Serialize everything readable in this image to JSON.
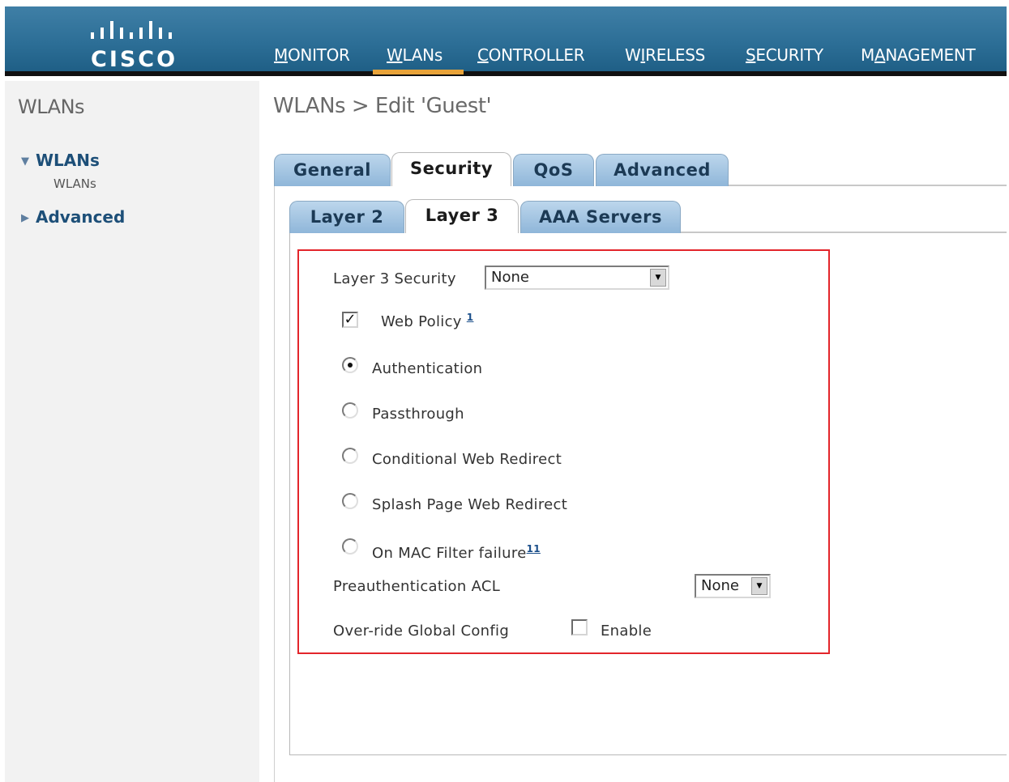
{
  "header": {
    "brand": "CISCO",
    "nav": [
      {
        "label": "MONITOR",
        "key": "M",
        "rest": "ONITOR"
      },
      {
        "label": "WLANs",
        "key": "W",
        "rest": "LANs"
      },
      {
        "label": "CONTROLLER",
        "key": "C",
        "rest": "ONTROLLER"
      },
      {
        "label": "WIRELESS",
        "pre": "W",
        "key": "I",
        "rest": "RELESS"
      },
      {
        "label": "SECURITY",
        "key": "S",
        "rest": "ECURITY"
      },
      {
        "label": "MANAGEMENT",
        "pre": "M",
        "key": "A",
        "rest": "NAGEMENT"
      }
    ],
    "active": "WLANs",
    "accent": "#e8a33a"
  },
  "sidebar": {
    "title": "WLANs",
    "items": [
      {
        "label": "WLANs",
        "expanded": true,
        "children": [
          "WLANs"
        ]
      },
      {
        "label": "Advanced",
        "expanded": false
      }
    ]
  },
  "main": {
    "title": "WLANs > Edit  'Guest'",
    "tabs": [
      "General",
      "Security",
      "QoS",
      "Advanced"
    ],
    "active_tab": "Security",
    "subtabs": [
      "Layer 2",
      "Layer 3",
      "AAA Servers"
    ],
    "active_subtab": "Layer 3",
    "form": {
      "layer3_security_label": "Layer 3 Security",
      "layer3_security_value": "None",
      "web_policy_label": "Web Policy",
      "web_policy_checked": true,
      "web_policy_note": "1",
      "radios": [
        {
          "label": "Authentication",
          "selected": true,
          "note": ""
        },
        {
          "label": "Passthrough",
          "selected": false,
          "note": ""
        },
        {
          "label": "Conditional Web Redirect",
          "selected": false,
          "note": ""
        },
        {
          "label": "Splash Page Web Redirect",
          "selected": false,
          "note": ""
        },
        {
          "label": "On MAC Filter failure",
          "selected": false,
          "note": "11"
        }
      ],
      "preauth_acl_label": "Preauthentication ACL",
      "preauth_acl_value": "None",
      "override_label": "Over-ride Global Config",
      "override_checkbox_label": "Enable",
      "override_checked": false
    },
    "highlight_color": "#e3252b"
  }
}
